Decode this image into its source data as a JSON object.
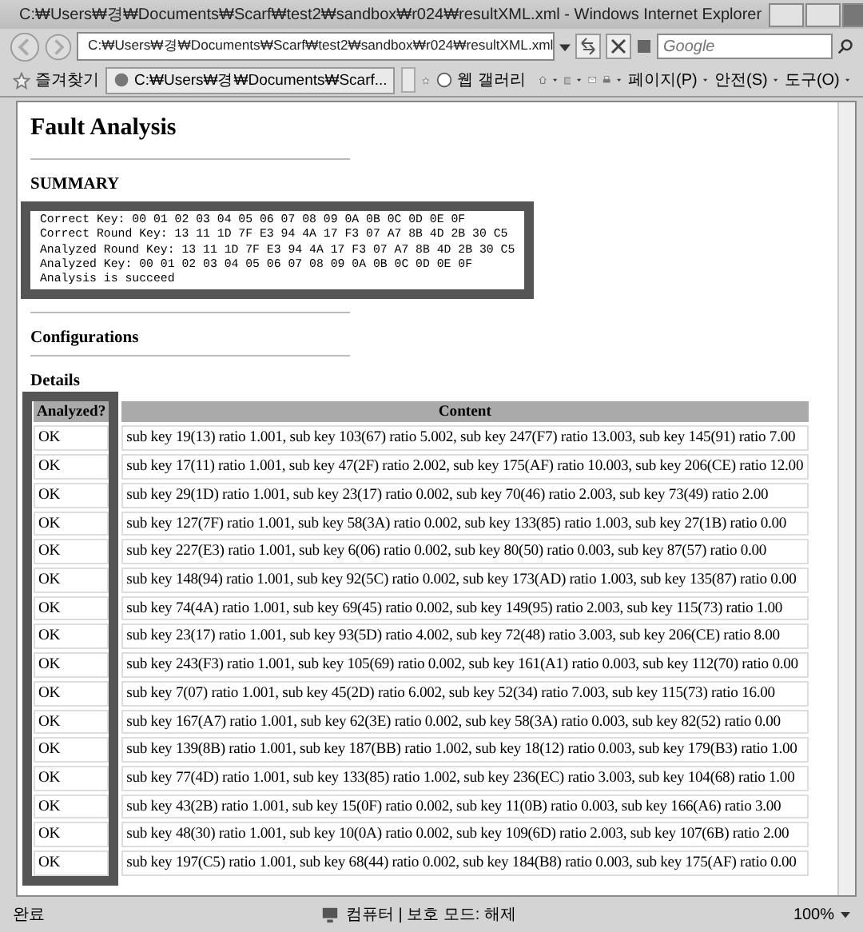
{
  "window": {
    "title": "C:₩Users₩경₩Documents₩Scarf₩test2₩sandbox₩r024₩resultXML.xml - Windows Internet Explorer"
  },
  "address_bar": {
    "url": "C:₩Users₩경₩Documents₩Scarf₩test2₩sandbox₩r024₩resultXML.xml"
  },
  "search": {
    "placeholder": "Google"
  },
  "command_bar": {
    "favorites_label": "즐겨찾기",
    "tab_title": "C:₩Users₩경₩Documents₩Scarf...",
    "web_slice_label": "웹 갤러리",
    "menus": [
      "페이지(P)",
      "안전(S)",
      "도구(O)"
    ]
  },
  "page": {
    "heading": "Fault Analysis",
    "summary": {
      "title": "SUMMARY",
      "lines": [
        "Correct Key: 00 01 02 03 04 05 06 07 08 09 0A 0B 0C 0D 0E 0F",
        "Correct Round Key: 13 11 1D 7F E3 94 4A 17 F3 07 A7 8B 4D 2B 30 C5",
        "Analyzed Round Key: 13 11 1D 7F E3 94 4A 17 F3 07 A7 8B 4D 2B 30 C5",
        "Analyzed Key: 00 01 02 03 04 05 06 07 08 09 0A 0B 0C 0D 0E 0F",
        "Analysis is succeed"
      ]
    },
    "configurations": {
      "title": "Configurations"
    },
    "details": {
      "title": "Details",
      "columns": [
        "Analyzed?",
        "Content"
      ],
      "rows": [
        [
          "OK",
          "sub key 19(13) ratio 1.001, sub key 103(67) ratio 5.002, sub key 247(F7) ratio 13.003, sub key 145(91) ratio 7.00"
        ],
        [
          "OK",
          "sub key 17(11) ratio 1.001, sub key 47(2F) ratio 2.002, sub key 175(AF) ratio 10.003, sub key 206(CE) ratio 12.00"
        ],
        [
          "OK",
          "sub key 29(1D) ratio 1.001, sub key 23(17) ratio 0.002, sub key 70(46) ratio 2.003, sub key 73(49) ratio 2.00"
        ],
        [
          "OK",
          "sub key 127(7F) ratio 1.001, sub key 58(3A) ratio 0.002, sub key 133(85) ratio 1.003, sub key 27(1B) ratio 0.00"
        ],
        [
          "OK",
          "sub key 227(E3) ratio 1.001, sub key 6(06) ratio 0.002, sub key 80(50) ratio 0.003, sub key 87(57) ratio 0.00"
        ],
        [
          "OK",
          "sub key 148(94) ratio 1.001, sub key 92(5C) ratio 0.002, sub key 173(AD) ratio 1.003, sub key 135(87) ratio 0.00"
        ],
        [
          "OK",
          "sub key 74(4A) ratio 1.001, sub key 69(45) ratio 0.002, sub key 149(95) ratio 2.003, sub key 115(73) ratio 1.00"
        ],
        [
          "OK",
          "sub key 23(17) ratio 1.001, sub key 93(5D) ratio 4.002, sub key 72(48) ratio 3.003, sub key 206(CE) ratio 8.00"
        ],
        [
          "OK",
          "sub key 243(F3) ratio 1.001, sub key 105(69) ratio 0.002, sub key 161(A1) ratio 0.003, sub key 112(70) ratio 0.00"
        ],
        [
          "OK",
          "sub key 7(07) ratio 1.001, sub key 45(2D) ratio 6.002, sub key 52(34) ratio 7.003, sub key 115(73) ratio 16.00"
        ],
        [
          "OK",
          "sub key 167(A7) ratio 1.001, sub key 62(3E) ratio 0.002, sub key 58(3A) ratio 0.003, sub key 82(52) ratio 0.00"
        ],
        [
          "OK",
          "sub key 139(8B) ratio 1.001, sub key 187(BB) ratio 1.002, sub key 18(12) ratio 0.003, sub key 179(B3) ratio 1.00"
        ],
        [
          "OK",
          "sub key 77(4D) ratio 1.001, sub key 133(85) ratio 1.002, sub key 236(EC) ratio 3.003, sub key 104(68) ratio 1.00"
        ],
        [
          "OK",
          "sub key 43(2B) ratio 1.001, sub key 15(0F) ratio 0.002, sub key 11(0B) ratio 0.003, sub key 166(A6) ratio 3.00"
        ],
        [
          "OK",
          "sub key 48(30) ratio 1.001, sub key 10(0A) ratio 0.002, sub key 109(6D) ratio 2.003, sub key 107(6B) ratio 2.00"
        ],
        [
          "OK",
          "sub key 197(C5) ratio 1.001, sub key 68(44) ratio 0.002, sub key 184(B8) ratio 0.003, sub key 175(AF) ratio 0.00"
        ]
      ]
    }
  },
  "status_bar": {
    "status": "완료",
    "zone": "컴퓨터 | 보호 모드: 해제",
    "zoom": "100%"
  }
}
